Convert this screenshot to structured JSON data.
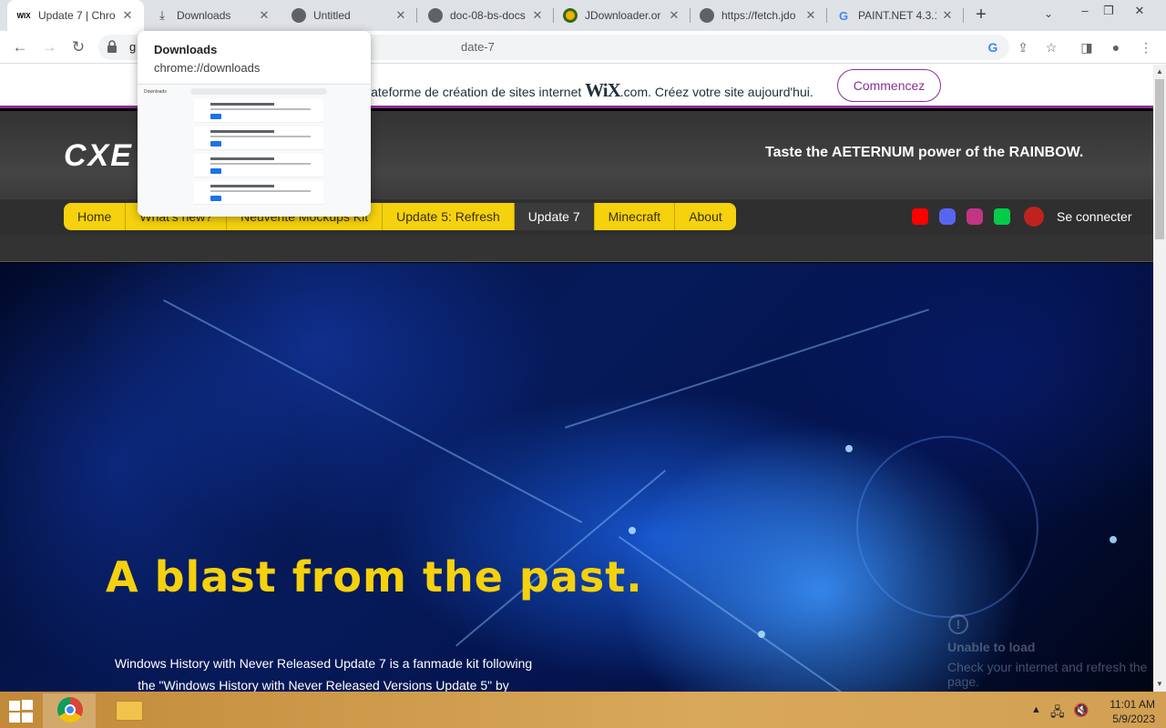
{
  "tabs": [
    {
      "title": "Update 7 | Chro",
      "favicon": "wix-icon",
      "active": true
    },
    {
      "title": "Downloads",
      "favicon": "download-icon",
      "active": false
    },
    {
      "title": "Untitled",
      "favicon": "globe-icon",
      "active": false
    },
    {
      "title": "doc-08-bs-docs",
      "favicon": "globe-icon",
      "active": false
    },
    {
      "title": "JDownloader.or",
      "favicon": "jdownloader-icon",
      "active": false
    },
    {
      "title": "https://fetch.jdo",
      "favicon": "globe-icon",
      "active": false
    },
    {
      "title": "PAINT.NET 4.3.1",
      "favicon": "google-icon",
      "active": false
    }
  ],
  "favicon_text": {
    "wix": "WIX",
    "google": "G"
  },
  "hovercard": {
    "title": "Downloads",
    "url": "chrome://downloads",
    "preview_label": "Downloads"
  },
  "omnibox": {
    "url_start": "g",
    "url_end": "date-7"
  },
  "wix_banner": {
    "text_before": "lateforme de création de sites internet ",
    "brand": "WiX",
    "text_after": ".com. Créez votre site aujourd'hui.",
    "button": "Commencez",
    "accent_color": "#8b2f94"
  },
  "site": {
    "logo": "CXE",
    "tagline": "Taste the AETERNUM power of the RAINBOW.",
    "menu": [
      {
        "label": "Home",
        "current": false
      },
      {
        "label": "What's new?",
        "current": false
      },
      {
        "label": "Neuvente Mockups Kit",
        "current": false
      },
      {
        "label": "Update 5: Refresh",
        "current": false
      },
      {
        "label": "Update 7",
        "current": true
      },
      {
        "label": "Minecraft",
        "current": false
      },
      {
        "label": "About",
        "current": false
      }
    ],
    "social": [
      {
        "name": "youtube-icon",
        "color": "#ff0000"
      },
      {
        "name": "discord-icon",
        "color": "#5865f2"
      },
      {
        "name": "instagram-icon",
        "color": "#c13584"
      },
      {
        "name": "deviantart-icon",
        "color": "#05cc47"
      }
    ],
    "signin": "Se connecter",
    "accent_color": "#f5d10e"
  },
  "hero": {
    "heading": "A blast from the past.",
    "description": "Windows History with Never Released Update 7 is a fanmade kit following the \"Windows History with Never Released Versions Update 5\" by",
    "offline_title": "Unable to load",
    "offline_text": "Check your internet and refresh the page."
  },
  "taskbar": {
    "time": "11:01 AM",
    "date": "5/9/2023"
  }
}
